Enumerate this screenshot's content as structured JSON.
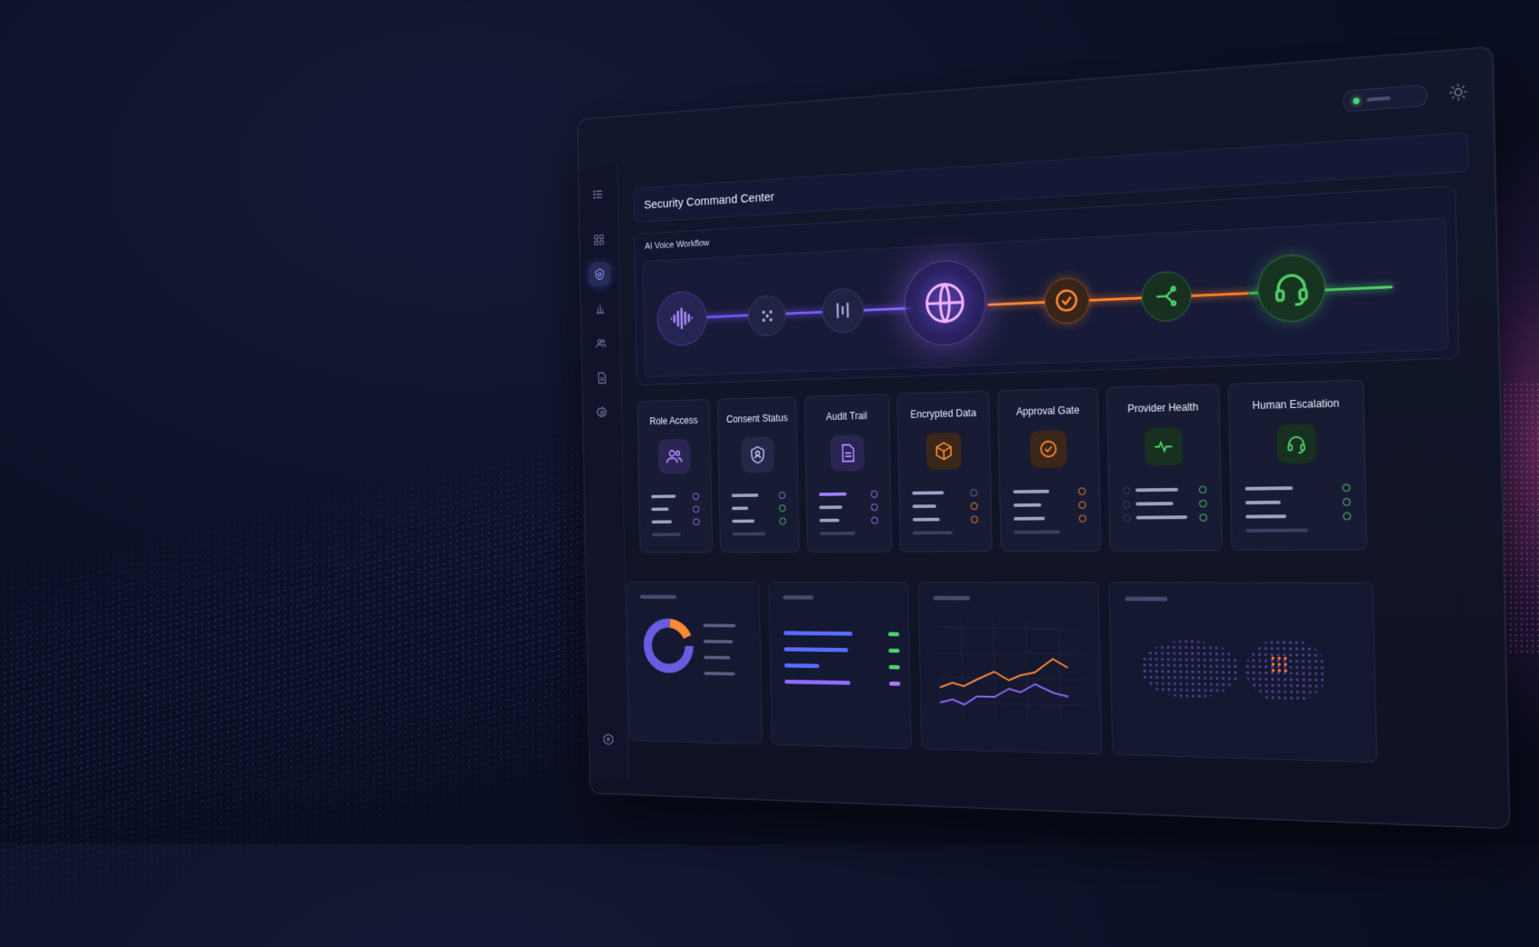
{
  "app": {
    "title": "Security Command Center"
  },
  "sidebar": {
    "items": [
      {
        "name": "menu",
        "icon": "menu-icon"
      },
      {
        "name": "dashboard",
        "icon": "grid-icon"
      },
      {
        "name": "security",
        "icon": "shield-icon",
        "active": true
      },
      {
        "name": "analytics",
        "icon": "bar-chart-icon"
      },
      {
        "name": "users",
        "icon": "users-icon"
      },
      {
        "name": "documents",
        "icon": "document-icon"
      },
      {
        "name": "settings",
        "icon": "gear-icon"
      }
    ],
    "footer_icon": "hexagon-icon"
  },
  "workflow": {
    "label": "AI Voice Workflow",
    "nodes": [
      {
        "name": "voice-input",
        "icon": "waveform-icon",
        "color": "#9b7dff"
      },
      {
        "name": "speech-detect",
        "icon": "dots-icon",
        "color": "#9aa0d8"
      },
      {
        "name": "signal-process",
        "icon": "bars-icon",
        "color": "#9aa0d8"
      },
      {
        "name": "ai-core",
        "icon": "globe-icon",
        "color": "#b678ff"
      },
      {
        "name": "approval",
        "icon": "check-icon",
        "color": "#ff8a33"
      },
      {
        "name": "routing",
        "icon": "branch-icon",
        "color": "#4fd16a"
      },
      {
        "name": "human-agent",
        "icon": "headset-icon",
        "color": "#4fd16a"
      }
    ]
  },
  "cards": [
    {
      "title": "Role Access",
      "icon": "users-icon",
      "accent": "#a87dff"
    },
    {
      "title": "Consent Status",
      "icon": "shield-user-icon",
      "accent": "#a87dff"
    },
    {
      "title": "Audit Trail",
      "icon": "document-icon",
      "accent": "#a87dff"
    },
    {
      "title": "Encrypted Data",
      "icon": "cube-icon",
      "accent": "#ff8a33"
    },
    {
      "title": "Approval Gate",
      "icon": "check-circle-icon",
      "accent": "#ff8a33"
    },
    {
      "title": "Provider Health",
      "icon": "pulse-icon",
      "accent": "#4fd16a"
    },
    {
      "title": "Human Escalation",
      "icon": "headset-icon",
      "accent": "#4fd16a"
    }
  ],
  "status": {
    "online_color": "#4ed37a"
  },
  "palette": {
    "purple": "#8f6bff",
    "orange": "#ff8a33",
    "green": "#4fd16a",
    "blue": "#5a6cff"
  }
}
